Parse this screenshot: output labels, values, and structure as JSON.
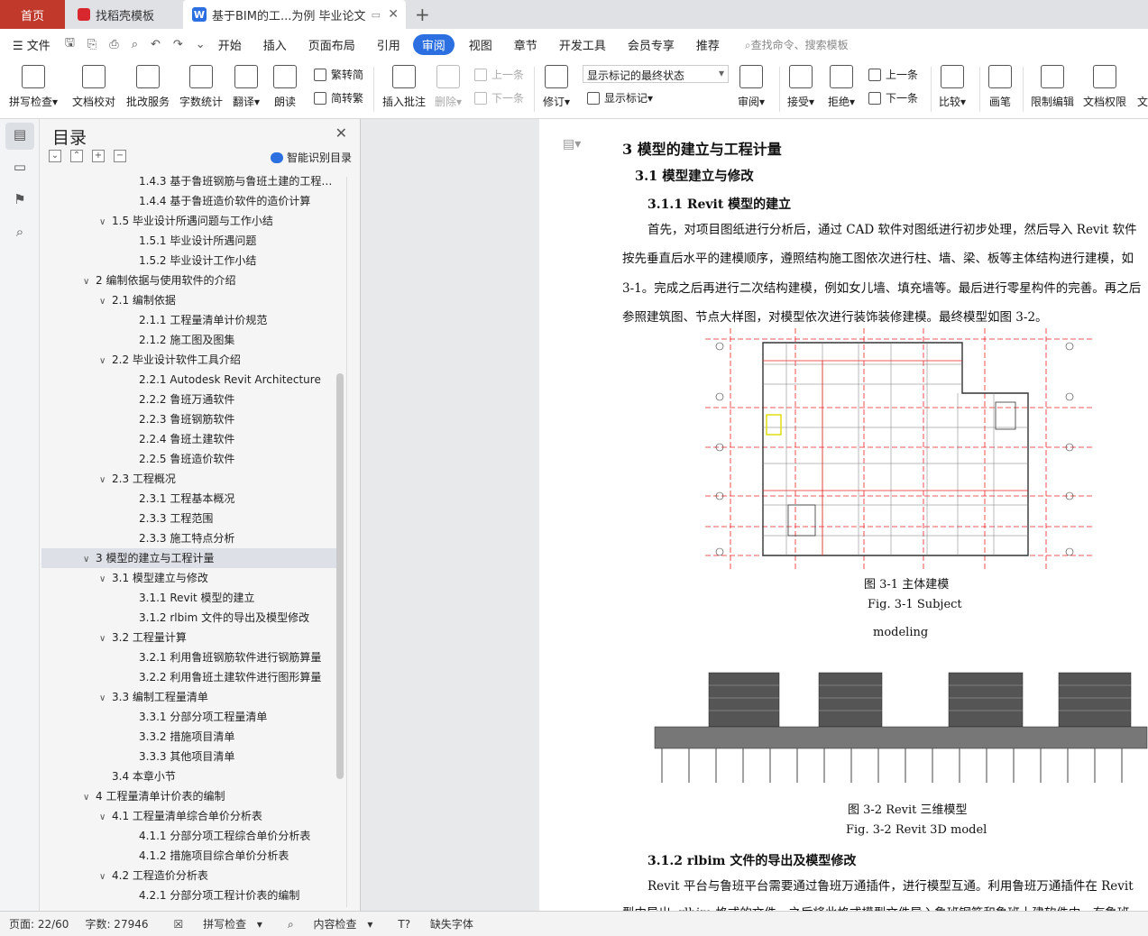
{
  "tabs": {
    "home": "首页",
    "template": "找稻壳模板",
    "document": "基于BIM的工...为例 毕业论文"
  },
  "menu": {
    "file": "文件",
    "items": [
      "开始",
      "插入",
      "页面布局",
      "引用",
      "审阅",
      "视图",
      "章节",
      "开发工具",
      "会员专享",
      "推荐"
    ],
    "active": "审阅",
    "search": "查找命令、搜索模板"
  },
  "ribbon": {
    "spellcheck": "拼写检查",
    "doc_proof": "文档校对",
    "batch_service": "批改服务",
    "word_count": "字数统计",
    "translate": "翻译",
    "read_aloud": "朗读",
    "to_traditional": "繁转简",
    "to_simplified": "简转繁",
    "insert_comment": "插入批注",
    "delete": "删除",
    "prev_comment": "上一条",
    "next_comment": "下一条",
    "revise": "修订",
    "markup_state": "显示标记的最终状态",
    "show_markup": "显示标记",
    "review": "审阅",
    "accept": "接受",
    "reject": "拒绝",
    "prev_change": "上一条",
    "next_change": "下一条",
    "compare": "比较",
    "pen": "画笔",
    "restrict_edit": "限制编辑",
    "doc_permission": "文档权限",
    "more": "文"
  },
  "toc": {
    "title": "目录",
    "smart": "智能识别目录",
    "items": [
      {
        "text": "1.4.3 基于鲁班钢筋与鲁班土建的工程量...",
        "level": 3,
        "caret": ""
      },
      {
        "text": "1.4.4 基于鲁班造价软件的造价计算",
        "level": 3,
        "caret": ""
      },
      {
        "text": "1.5 毕业设计所遇问题与工作小结",
        "level": 2,
        "caret": "⌄"
      },
      {
        "text": "1.5.1 毕业设计所遇问题",
        "level": 3,
        "caret": ""
      },
      {
        "text": "1.5.2 毕业设计工作小结",
        "level": 3,
        "caret": ""
      },
      {
        "text": "2 编制依据与使用软件的介绍",
        "level": 1,
        "caret": "⌄"
      },
      {
        "text": "2.1 编制依据",
        "level": 2,
        "caret": "⌄"
      },
      {
        "text": "2.1.1 工程量清单计价规范",
        "level": 3,
        "caret": ""
      },
      {
        "text": "2.1.2 施工图及图集",
        "level": 3,
        "caret": ""
      },
      {
        "text": "2.2 毕业设计软件工具介绍",
        "level": 2,
        "caret": "⌄"
      },
      {
        "text": "2.2.1 Autodesk Revit Architecture",
        "level": 3,
        "caret": ""
      },
      {
        "text": "2.2.2 鲁班万通软件",
        "level": 3,
        "caret": ""
      },
      {
        "text": "2.2.3 鲁班钢筋软件",
        "level": 3,
        "caret": ""
      },
      {
        "text": "2.2.4 鲁班土建软件",
        "level": 3,
        "caret": ""
      },
      {
        "text": "2.2.5 鲁班造价软件",
        "level": 3,
        "caret": ""
      },
      {
        "text": "2.3 工程概况",
        "level": 2,
        "caret": "⌄"
      },
      {
        "text": "2.3.1 工程基本概况",
        "level": 3,
        "caret": ""
      },
      {
        "text": "2.3.3 工程范围",
        "level": 3,
        "caret": ""
      },
      {
        "text": "2.3.3 施工特点分析",
        "level": 3,
        "caret": ""
      },
      {
        "text": "3 模型的建立与工程计量",
        "level": 1,
        "caret": "⌄",
        "selected": true
      },
      {
        "text": "3.1 模型建立与修改",
        "level": 2,
        "caret": "⌄"
      },
      {
        "text": "3.1.1 Revit 模型的建立",
        "level": 3,
        "caret": ""
      },
      {
        "text": "3.1.2 rlbim 文件的导出及模型修改",
        "level": 3,
        "caret": ""
      },
      {
        "text": "3.2 工程量计算",
        "level": 2,
        "caret": "⌄"
      },
      {
        "text": "3.2.1 利用鲁班钢筋软件进行钢筋算量",
        "level": 3,
        "caret": ""
      },
      {
        "text": "3.2.2 利用鲁班土建软件进行图形算量",
        "level": 3,
        "caret": ""
      },
      {
        "text": "3.3 编制工程量清单",
        "level": 2,
        "caret": "⌄"
      },
      {
        "text": "3.3.1 分部分项工程量清单",
        "level": 3,
        "caret": ""
      },
      {
        "text": "3.3.2 措施项目清单",
        "level": 3,
        "caret": ""
      },
      {
        "text": "3.3.3 其他项目清单",
        "level": 3,
        "caret": ""
      },
      {
        "text": "3.4 本章小节",
        "level": 2,
        "caret": ""
      },
      {
        "text": "4 工程量清单计价表的编制",
        "level": 1,
        "caret": "⌄"
      },
      {
        "text": "4.1 工程量清单综合单价分析表",
        "level": 2,
        "caret": "⌄"
      },
      {
        "text": "4.1.1 分部分项工程综合单价分析表",
        "level": 3,
        "caret": ""
      },
      {
        "text": "4.1.2 措施项目综合单价分析表",
        "level": 3,
        "caret": ""
      },
      {
        "text": "4.2 工程造价分析表",
        "level": 2,
        "caret": "⌄"
      },
      {
        "text": "4.2.1 分部分项工程计价表的编制",
        "level": 3,
        "caret": ""
      }
    ]
  },
  "document": {
    "h1": "3 模型的建立与工程计量",
    "h2": "3.1 模型建立与修改",
    "h3a": "3.1.1 Revit  模型的建立",
    "para1": [
      "首先，对项目图纸进行分析后，通过  CAD  软件对图纸进行初步处理，然后导入  Revit  软件",
      "按先垂直后水平的建模顺序，遵照结构施工图依次进行柱、墙、梁、板等主体结构进行建模，如",
      "3-1。完成之后再进行二次结构建模，例如女儿墙、填充墙等。最后进行零星构件的完善。再之后",
      "参照建筑图、节点大样图，对模型依次进行装饰装修建模。最终模型如图 3-2。"
    ],
    "fig1_caption_cn": "图 3-1  主体建模",
    "fig1_caption_en1": "Fig. 3-1 Subject",
    "fig1_caption_en2": "modeling",
    "fig2_caption_cn": "图 3-2 Revit  三维模型",
    "fig2_caption_en": "Fig. 3-2 Revit 3D model",
    "h3b": "3.1.2 rlbim 文件的导出及模型修改",
    "para2": [
      "Revit  平台与鲁班平台需要通过鲁班万通插件，进行模型互通。利用鲁班万通插件在  Revit",
      "型中导出 .rlbim 格式的文件，之后将此格式模型文件导入鲁班钢筋和鲁班土建软件中，有鲁班"
    ]
  },
  "status": {
    "page": "页面: 22/60",
    "words": "字数: 27946",
    "spell": "拼写检查",
    "content_check": "内容检查",
    "missing_font": "缺失字体"
  }
}
